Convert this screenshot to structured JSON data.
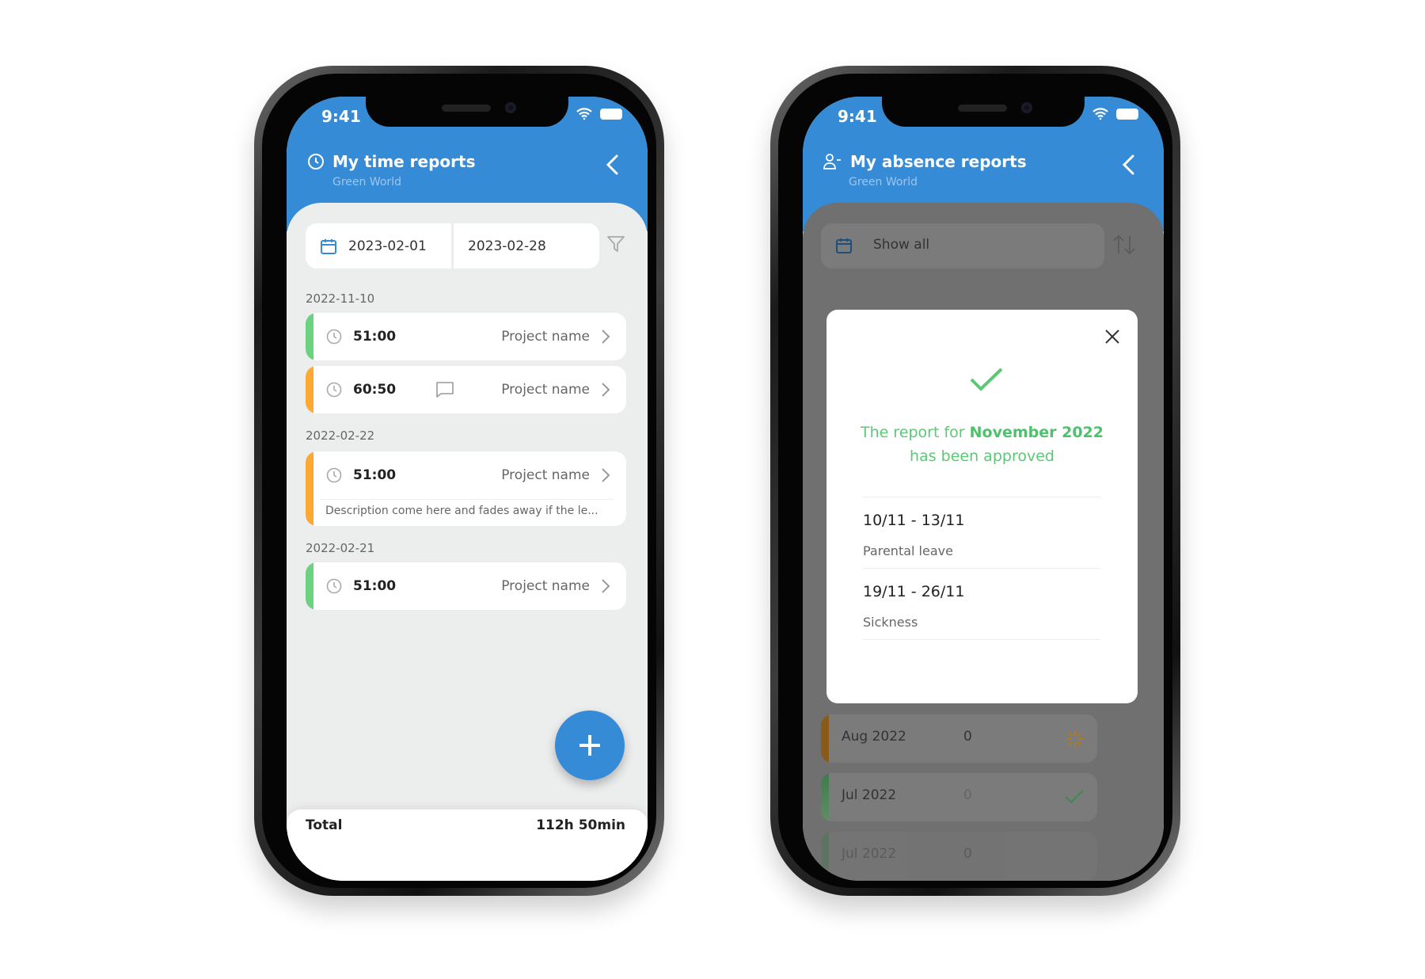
{
  "left_phone": {
    "status_time": "9:41",
    "header": {
      "title": "My time reports",
      "subtitle": "Green World",
      "icon": "clock-icon"
    },
    "date_filter": {
      "from": "2023-02-01",
      "to": "2023-02-28"
    },
    "groups": [
      {
        "date": "2022-11-10",
        "entries": [
          {
            "duration": "51:00",
            "project": "Project name",
            "status_color": "#6CD27F",
            "has_comment": false
          },
          {
            "duration": "60:50",
            "project": "Project name",
            "status_color": "#FBA932",
            "has_comment": true
          }
        ]
      },
      {
        "date": "2022-02-22",
        "entries": [
          {
            "duration": "51:00",
            "project": "Project name",
            "status_color": "#FBA932",
            "description": "Description come here and fades away if the le..."
          }
        ]
      },
      {
        "date": "2022-02-21",
        "entries": [
          {
            "duration": "51:00",
            "project": "Project name",
            "status_color": "#6CD27F"
          }
        ]
      }
    ],
    "total": {
      "label": "Total",
      "value": "112h 50min"
    }
  },
  "right_phone": {
    "status_time": "9:41",
    "header": {
      "title": "My absence reports",
      "subtitle": "Green World",
      "icon": "user-minus-icon"
    },
    "filter": {
      "label": "Show all"
    },
    "months": [
      {
        "label": "Aug 2022",
        "count": "0",
        "status": "pending",
        "status_color": "#8a5a1a"
      },
      {
        "label": "Jul 2022",
        "count": "0",
        "status": "approved",
        "status_color": "#3f7a4c"
      },
      {
        "label": "Jul 2022",
        "count": "0",
        "status": "approved",
        "status_color": "#3f7a4c"
      }
    ],
    "modal": {
      "message_prefix": "The report for",
      "message_month": "November 2022",
      "message_suffix": "has been approved",
      "absences": [
        {
          "dates": "10/11 - 13/11",
          "type": "Parental leave"
        },
        {
          "dates": "19/11 - 26/11",
          "type": "Sickness"
        }
      ]
    }
  },
  "colors": {
    "primary": "#368BD6",
    "success": "#5CC876",
    "warning": "#FBA932",
    "background": "#ECEDED"
  }
}
